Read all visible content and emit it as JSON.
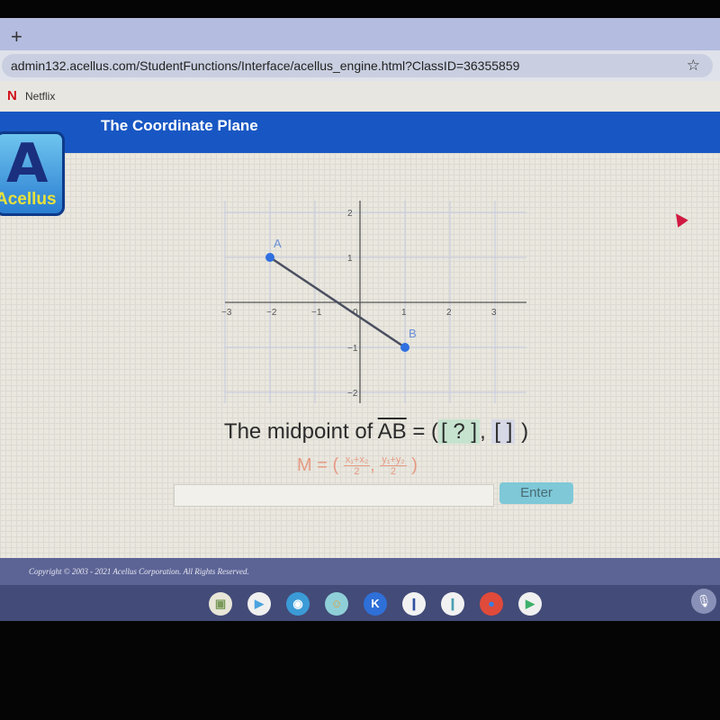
{
  "browser": {
    "new_tab_icon": "plus-icon",
    "url": "admin132.acellus.com/StudentFunctions/Interface/acellus_engine.html?ClassID=36355859",
    "bookmark_star_icon": "star-icon",
    "bookmarks": [
      {
        "icon": "netflix-logo-icon",
        "label": "Netflix"
      }
    ]
  },
  "banner": {
    "title": "The Coordinate Plane"
  },
  "logo": {
    "glyph": "A",
    "text": "Acellus"
  },
  "graph": {
    "x_ticks": [
      "-3",
      "-2",
      "-1",
      "0",
      "1",
      "2",
      "3"
    ],
    "y_ticks": [
      "2",
      "1",
      "-1",
      "-2"
    ],
    "points": [
      {
        "label": "A",
        "x": -2,
        "y": 1
      },
      {
        "label": "B",
        "x": 1,
        "y": -1
      }
    ],
    "point_color": "#2f6fe0"
  },
  "question": {
    "prefix": "The midpoint of ",
    "segment": "AB",
    "equals": " = (",
    "answer_x": "[ ? ]",
    "comma": ", ",
    "answer_y": "[   ]",
    "suffix": " )"
  },
  "formula": {
    "lhs": "M = (",
    "x_num": "x₁+x₂",
    "x_den": "2",
    "sep": ",",
    "y_num": "y₁+y₂",
    "y_den": "2",
    "rhs": ")"
  },
  "answer_input": {
    "value": "",
    "placeholder": ""
  },
  "enter_button": {
    "label": "Enter"
  },
  "footer": {
    "copyright": "Copyright © 2003 - 2021 Acellus Corporation.  All Rights Reserved."
  },
  "shelf": {
    "apps": [
      {
        "name": "gallery",
        "glyph": "▣",
        "bg": "#e8e6d8",
        "fg": "#7a9a5a"
      },
      {
        "name": "play-store",
        "glyph": "▶",
        "bg": "#f0f0f0",
        "fg": "#4aa3df"
      },
      {
        "name": "camera",
        "glyph": "◉",
        "bg": "#3b9bd6",
        "fg": "#ffffff"
      },
      {
        "name": "fox-app",
        "glyph": "☺",
        "bg": "#8fd0d8",
        "fg": "#e0a040"
      },
      {
        "name": "kahoot",
        "glyph": "K",
        "bg": "#2f6fd8",
        "fg": "#ffffff"
      },
      {
        "name": "app-6",
        "glyph": "❙",
        "bg": "#f2f2f2",
        "fg": "#2f4fa0"
      },
      {
        "name": "app-7",
        "glyph": "❙",
        "bg": "#f2f2f2",
        "fg": "#4aa0b0"
      },
      {
        "name": "chrome",
        "glyph": "●",
        "bg": "#e04a3a",
        "fg": "#3b7de0"
      },
      {
        "name": "play",
        "glyph": "▶",
        "bg": "#f0f0f0",
        "fg": "#3bb06a"
      }
    ],
    "mic_icon": "microphone-icon"
  }
}
